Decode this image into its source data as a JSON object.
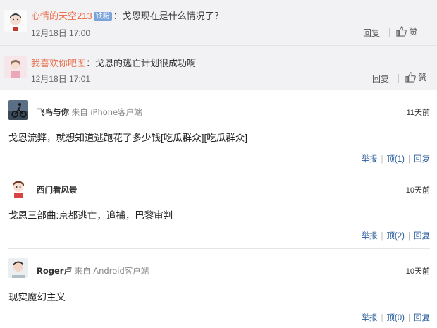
{
  "nested_replies": [
    {
      "user": "心情的天空213",
      "badge": "铁粉",
      "text": "：戈恩现在是什么情况了？",
      "time": "12月18日 17:00",
      "reply_label": "回复",
      "like_label": "赞"
    },
    {
      "user": "我喜欢你吧图",
      "text": "：戈恩的逃亡计划很成功啊",
      "time": "12月18日 17:01",
      "reply_label": "回复",
      "like_label": "赞"
    }
  ],
  "comments": [
    {
      "user": "飞鸟与你",
      "source": "来自 iPhone客户端",
      "time": "11天前",
      "text": "戈恩流弊，就想知道逃跑花了多少钱[吃瓜群众][吃瓜群众]",
      "report_label": "举报",
      "up_label": "顶(1)",
      "reply_label": "回复"
    },
    {
      "user": "西门看风景",
      "source": "",
      "time": "10天前",
      "text": "戈恩三部曲:京都逃亡，追捕，巴黎审判",
      "report_label": "举报",
      "up_label": "顶(2)",
      "reply_label": "回复"
    },
    {
      "user": "Roger卢",
      "source": "来自 Android客户端",
      "time": "10天前",
      "text": "现实魔幻主义",
      "report_label": "举报",
      "up_label": "顶(0)",
      "reply_label": "回复"
    }
  ],
  "colors": {
    "username": "#eb7350",
    "action_link": "#2a5d9c",
    "badge": "#7aa4d8"
  }
}
